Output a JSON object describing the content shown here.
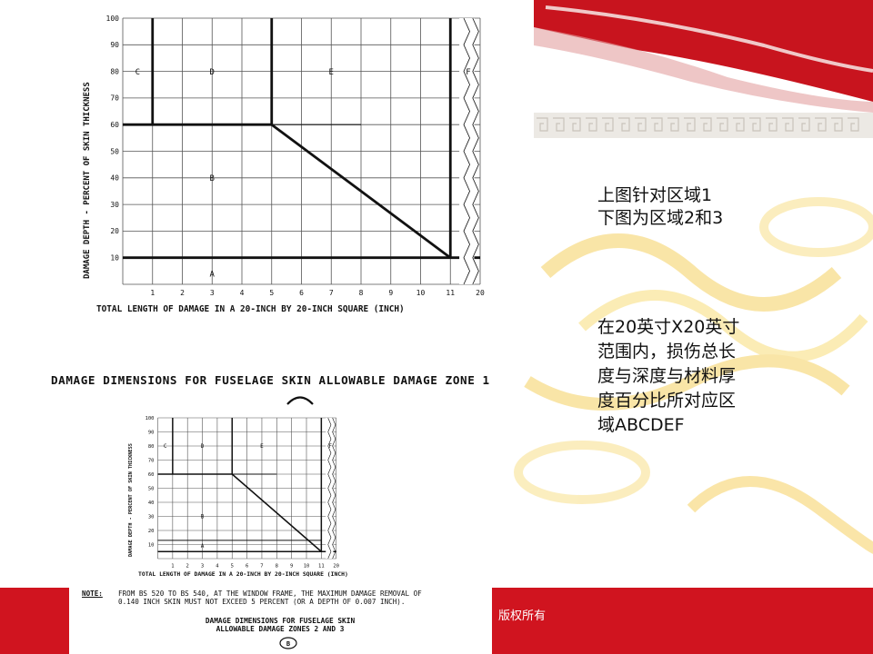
{
  "slide": {
    "note_zone1": "上图针对区域1",
    "note_zone23": "下图为区域2和3",
    "explain_lines": [
      "在20英寸X20英寸",
      "范围内，损伤总长",
      "度与深度与材料厚",
      "度百分比所对应区",
      "域ABCDEF"
    ],
    "footer": "版权所有"
  },
  "colors": {
    "banner_red": "#c8141e",
    "footer_red": "#d0141f",
    "gold": "#f5d060"
  },
  "chart1": {
    "ylabel": "DAMAGE DEPTH - PERCENT OF SKIN THICKNESS",
    "xlabel": "TOTAL LENGTH OF DAMAGE IN A 20-INCH BY 20-INCH SQUARE (INCH)",
    "caption": "DAMAGE DIMENSIONS FOR FUSELAGE SKIN ALLOWABLE DAMAGE ZONE 1",
    "x_ticks": [
      "1",
      "2",
      "3",
      "4",
      "5",
      "6",
      "7",
      "8",
      "9",
      "10",
      "11",
      "20"
    ],
    "y_ticks": [
      "10",
      "20",
      "30",
      "40",
      "50",
      "60",
      "70",
      "80",
      "90",
      "100"
    ],
    "regions": {
      "A": "A",
      "B": "B",
      "C": "C",
      "D": "D",
      "E": "E",
      "F": "F"
    }
  },
  "chart2": {
    "ylabel": "DAMAGE DEPTH - PERCENT OF SKIN THICKNESS",
    "xlabel": "TOTAL LENGTH OF DAMAGE IN A 20-INCH BY 20-INCH SQUARE (INCH)",
    "x_ticks": [
      "1",
      "2",
      "3",
      "4",
      "5",
      "6",
      "7",
      "8",
      "9",
      "10",
      "11",
      "20"
    ],
    "y_ticks": [
      "10",
      "20",
      "30",
      "40",
      "50",
      "60",
      "70",
      "80",
      "90",
      "100"
    ],
    "regions": {
      "A": "A",
      "B": "B",
      "C": "C",
      "D": "D",
      "E": "E",
      "F": "F"
    },
    "note_label": "NOTE:",
    "note_lines": [
      "FROM BS 520 TO BS 540, AT THE WINDOW FRAME, THE MAXIMUM DAMAGE REMOVAL OF",
      "0.140 INCH SKIN MUST NOT EXCEED 5 PERCENT (OR A DEPTH OF 0.007 INCH)."
    ],
    "caption_lines": [
      "DAMAGE DIMENSIONS FOR FUSELAGE SKIN",
      "ALLOWABLE DAMAGE ZONES 2 AND 3"
    ],
    "marker": "B"
  }
}
